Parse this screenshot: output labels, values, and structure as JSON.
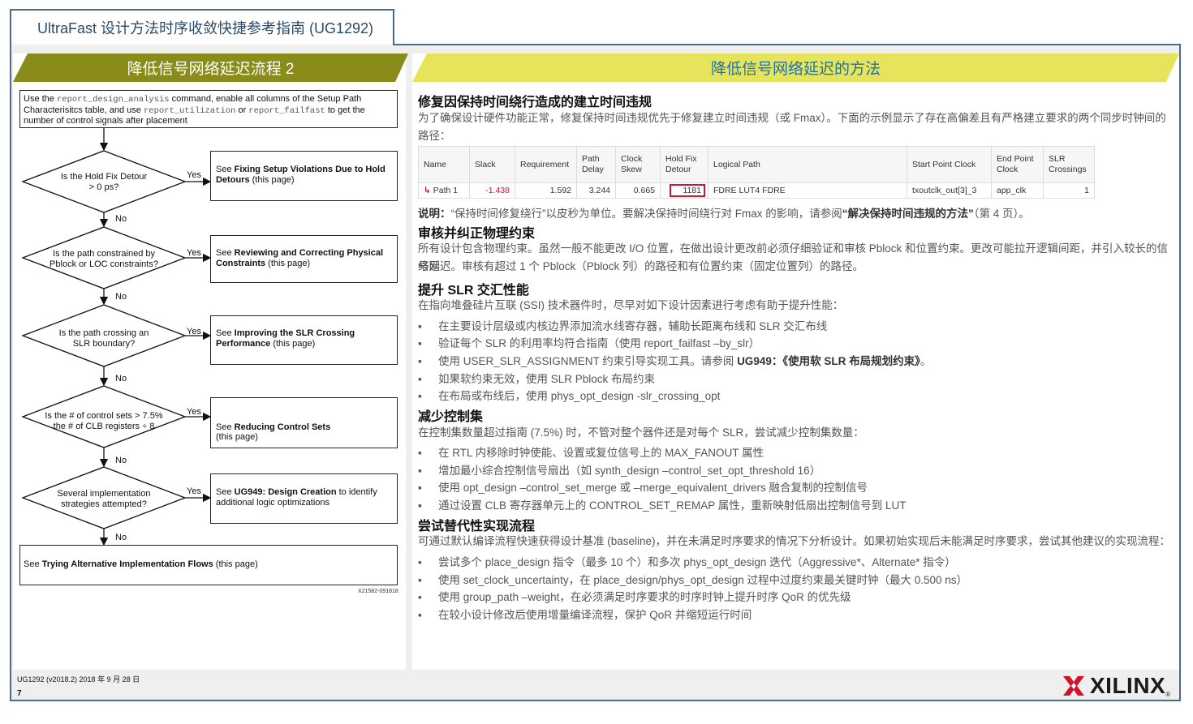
{
  "doc_title": "UltraFast 设计方法时序收敛快捷参考指南 (UG1292)",
  "left": {
    "banner": "降低信号网络延迟流程 2",
    "intro": {
      "t1": "Use the ",
      "c1": "report_design_analysis",
      "t2": " command, enable all columns of the Setup Path Characterisitcs table, and use ",
      "c2": "report_utilization",
      "t3": " or ",
      "c3": "report_failfast",
      "t4": " to get the number of control signals after placement"
    },
    "decisions": [
      {
        "q": "Is the Hold Fix Detour\n> 0 ps?",
        "yes": "Yes",
        "no": "No",
        "pre": "See ",
        "bold": "Fixing Setup Violations Due to Hold Detours",
        "post": " (this page)"
      },
      {
        "q": "Is the path constrained by\nPblock or LOC constraints?",
        "yes": "Yes",
        "no": "No",
        "pre": "See ",
        "bold": "Reviewing and Correcting Physical Constraints",
        "post": " (this page)"
      },
      {
        "q": "Is the path crossing an\nSLR boundary?",
        "yes": "Yes",
        "no": "No",
        "pre": "See ",
        "bold": "Improving the SLR Crossing Performance",
        "post": " (this page)"
      },
      {
        "q": "Is the # of control sets > 7.5%\nthe # of CLB registers ÷ 8",
        "yes": "Yes",
        "no": "No",
        "pre": "See ",
        "bold": "Reducing Control Sets",
        "post": "\n(this page)"
      },
      {
        "q": "Several implementation\nstrategies attempted?",
        "yes": "Yes",
        "no": "No",
        "pre": "See ",
        "bold": "UG949: Design Creation",
        "post": " to identify additional logic optimizations"
      }
    ],
    "final": {
      "pre": "See ",
      "bold": "Trying Alternative Implementation Flows",
      "post": " (this page)"
    },
    "fig_id": "X21582-091818"
  },
  "right": {
    "banner": "降低信号网络延迟的方法",
    "s1": {
      "title": "修复因保持时间绕行造成的建立时间违规",
      "para": "为了确保设计硬件功能正常，修复保持时间违规优先于修复建立时间违规（或 Fmax）。下面的示例显示了存在高偏差且有严格建立要求的两个同步时钟间的路径："
    },
    "table": {
      "headers": [
        "Name",
        "Slack",
        "Requirement",
        "Path\nDelay",
        "Clock\nSkew",
        "Hold Fix\nDetour",
        "Logical Path",
        "Start Point Clock",
        "End Point\nClock",
        "SLR\nCrossings"
      ],
      "row": [
        "Path 1",
        "-1.438",
        "1.592",
        "3.244",
        "0.665",
        "1181",
        "FDRE LUT4 FDRE",
        "txoutclk_out[3]_3",
        "app_clk",
        "1"
      ]
    },
    "note": {
      "label": "说明：",
      "t1": "“保持时间修复绕行”以皮秒为单位。要解决保持时间绕行对 Fmax 的影响，请参阅",
      "bold": "“解决保持时间违规的方法”",
      "t2": "（第 4 页）。"
    },
    "s2": {
      "title": "审核并纠正物理约束",
      "line1": "所有设计包含物理约束。虽然一般不能更改 I/O 位置，在做出设计更改前必须仔细验证和审核 Pblock 和位置约束。更改可能拉开逻辑间距，并引入较长的信号网",
      "line2": "络延迟。审核有超过 1 个 Pblock（Pblock 列）的路径和有位置约束（固定位置列）的路径。"
    },
    "s3": {
      "title": "提升 SLR 交汇性能",
      "para": "在指向堆叠硅片互联 (SSI) 技术器件时，尽早对如下设计因素进行考虑有助于提升性能：",
      "bullets": [
        "在主要设计层级或内核边界添加流水线寄存器，辅助长距离布线和 SLR 交汇布线",
        "验证每个 SLR 的利用率均符合指南（使用 report_failfast –by_slr）",
        "如果软约束无效，使用 SLR Pblock 布局约束",
        "在布局或布线后，使用 phys_opt_design -slr_crossing_opt"
      ],
      "b3": {
        "t": "使用 USER_SLR_ASSIGNMENT 约束引导实现工具。请参阅 ",
        "bold": "UG949：《使用软 SLR 布局规划约束》",
        "end": "。"
      }
    },
    "s4": {
      "title": "减少控制集",
      "para": "在控制集数量超过指南 (7.5%) 时，不管对整个器件还是对每个 SLR，尝试减少控制集数量：",
      "bullets": [
        "在 RTL 内移除时钟使能、设置或复位信号上的 MAX_FANOUT 属性",
        "增加最小综合控制信号扇出（如 synth_design –control_set_opt_threshold 16）",
        "使用 opt_design –control_set_merge 或 –merge_equivalent_drivers 融合复制的控制信号",
        "通过设置 CLB 寄存器单元上的 CONTROL_SET_REMAP 属性，重新映射低扇出控制信号到 LUT"
      ]
    },
    "s5": {
      "title": "尝试替代性实现流程",
      "para": "可通过默认编译流程快速获得设计基准 (baseline)，并在未满足时序要求的情况下分析设计。如果初始实现后未能满足时序要求，尝试其他建议的实现流程：",
      "bullets": [
        "尝试多个 place_design 指令（最多 10 个）和多次 phys_opt_design 迭代（Aggressive*、Alternate* 指令）",
        "使用 set_clock_uncertainty，在 place_design/phys_opt_design 过程中过度约束最关键时钟（最大 0.500 ns）",
        "使用 group_path –weight，在必须满足时序要求的时序时钟上提升时序 QoR 的优先级",
        "在较小设计修改后使用增量编译流程，保护 QoR 并缩短运行时间"
      ]
    },
    "bullet_char": "▪"
  },
  "footer": {
    "doc": "UG1292 (v2018.2) 2018 年 9 月 28 日",
    "page": "7",
    "logo": "XILINX",
    "tm": "®"
  },
  "colors": {
    "left_banner": "#8a8c1a",
    "right_banner": "#e5e45a",
    "right_banner_text": "#1f6fb0",
    "frame": "#4a6b8c",
    "slack_red": "#d0142c"
  }
}
